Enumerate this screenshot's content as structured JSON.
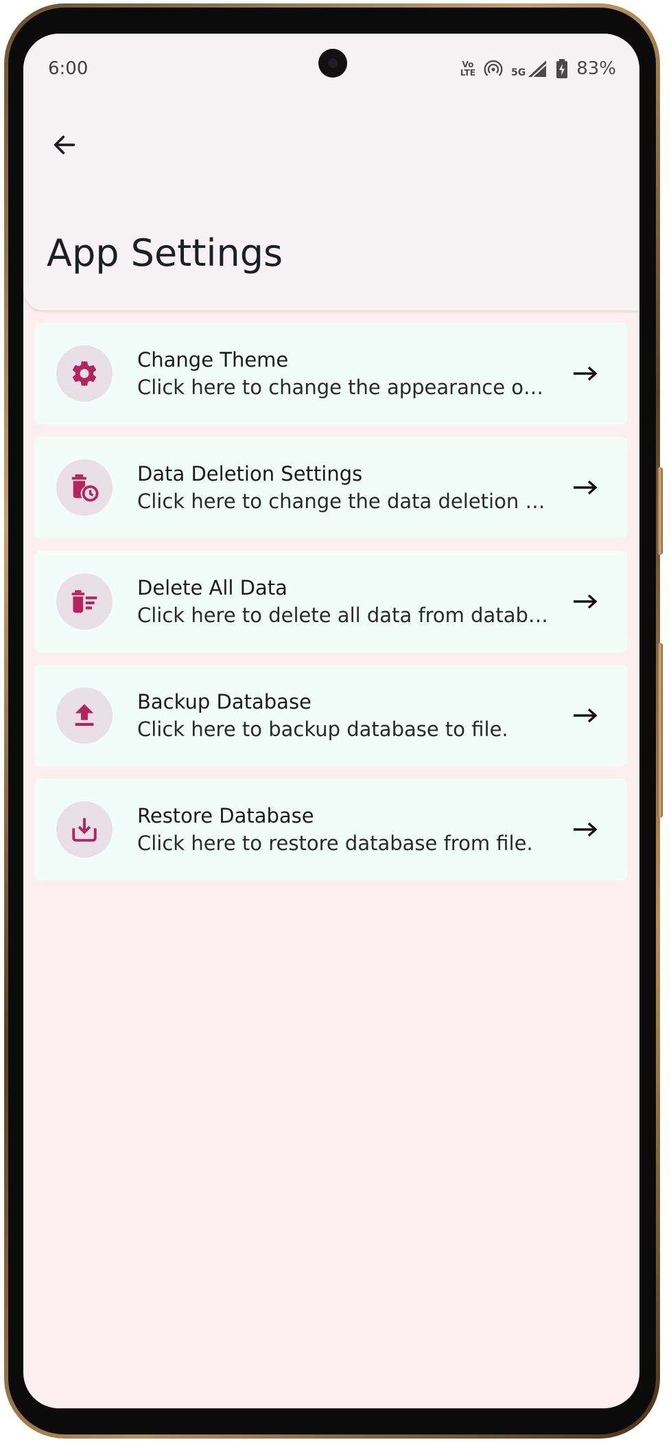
{
  "status_bar": {
    "time": "6:00",
    "volte_line1": "Vo",
    "volte_line2": "LTE",
    "network": "5G",
    "battery": "83%"
  },
  "header": {
    "title": "App Settings"
  },
  "settings": [
    {
      "title": "Change Theme",
      "subtitle": "Click here to change the appearance of the app.",
      "icon": "gear-icon"
    },
    {
      "title": "Data Deletion Settings",
      "subtitle": "Click here to change the data deletion settings.",
      "icon": "delete-clock-icon"
    },
    {
      "title": "Delete All Data",
      "subtitle": "Click here to delete all data from database.",
      "icon": "delete-sweep-icon"
    },
    {
      "title": "Backup Database",
      "subtitle": "Click here to backup database to file.",
      "icon": "upload-icon"
    },
    {
      "title": "Restore Database",
      "subtitle": "Click here to restore database from file.",
      "icon": "download-icon"
    }
  ],
  "colors": {
    "accent": "#b4245f",
    "background": "#fdeef2",
    "card": "#f0fdf8",
    "appbar": "#f7f2f4"
  }
}
